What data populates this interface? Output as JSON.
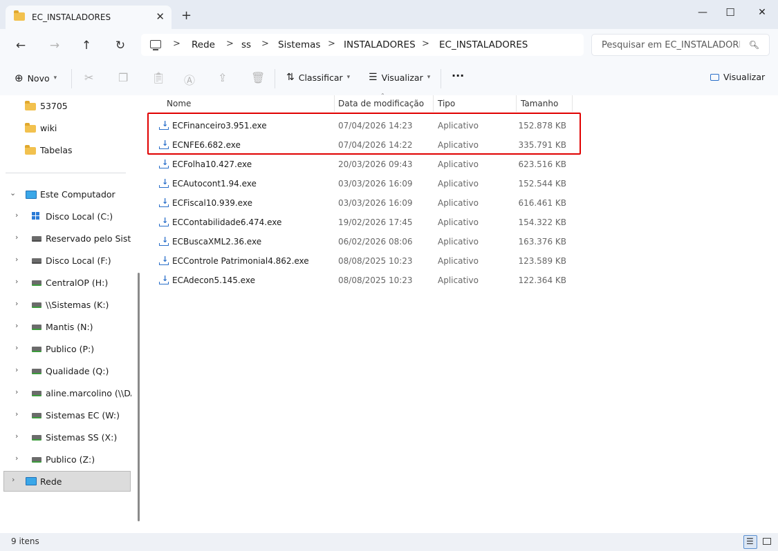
{
  "tab": {
    "title": "EC_INSTALADORES",
    "close": "✕",
    "new_tab": "+"
  },
  "window": {
    "minimize": "—",
    "maximize": "☐",
    "close": "✕"
  },
  "nav": {
    "back": "←",
    "forward": "→",
    "up": "↑",
    "refresh": "↻"
  },
  "breadcrumb": [
    "Rede",
    "ss",
    "Sistemas",
    "INSTALADORES",
    "EC_INSTALADORES"
  ],
  "search": {
    "placeholder": "Pesquisar em EC_INSTALADORES"
  },
  "toolbar": {
    "new_label": "Novo",
    "sort_label": "Classificar",
    "view_label": "Visualizar",
    "more": "···",
    "details_label": "Visualizar"
  },
  "sidebar": {
    "folders": [
      "53705",
      "wiki",
      "Tabelas"
    ],
    "computer_label": "Este Computador",
    "drives": [
      "Disco Local (C:)",
      "Reservado pelo Sistema",
      "Disco Local (F:)",
      "CentralOP (H:)",
      "\\\\Sistemas (K:)",
      "Mantis (N:)",
      "Publico (P:)",
      "Qualidade (Q:)",
      "aline.marcolino (\\\\DATA",
      "Sistemas EC (W:)",
      "Sistemas SS (X:)",
      "Publico (Z:)"
    ],
    "network_label": "Rede"
  },
  "columns": {
    "name": "Nome",
    "date": "Data de modificação",
    "type": "Tipo",
    "size": "Tamanho"
  },
  "files": [
    {
      "name": "ECFinanceiro3.951.exe",
      "date": "07/04/2026 14:23",
      "type": "Aplicativo",
      "size": "152.878 KB"
    },
    {
      "name": "ECNFE6.682.exe",
      "date": "07/04/2026 14:22",
      "type": "Aplicativo",
      "size": "335.791 KB"
    },
    {
      "name": "ECFolha10.427.exe",
      "date": "20/03/2026 09:43",
      "type": "Aplicativo",
      "size": "623.516 KB"
    },
    {
      "name": "ECAutocont1.94.exe",
      "date": "03/03/2026 16:09",
      "type": "Aplicativo",
      "size": "152.544 KB"
    },
    {
      "name": "ECFiscal10.939.exe",
      "date": "03/03/2026 16:09",
      "type": "Aplicativo",
      "size": "616.461 KB"
    },
    {
      "name": "ECContabilidade6.474.exe",
      "date": "19/02/2026 17:45",
      "type": "Aplicativo",
      "size": "154.322 KB"
    },
    {
      "name": "ECBuscaXML2.36.exe",
      "date": "06/02/2026 08:06",
      "type": "Aplicativo",
      "size": "163.376 KB"
    },
    {
      "name": "ECControle Patrimonial4.862.exe",
      "date": "08/08/2025 10:23",
      "type": "Aplicativo",
      "size": "123.589 KB"
    },
    {
      "name": "ECAdecon5.145.exe",
      "date": "08/08/2025 10:23",
      "type": "Aplicativo",
      "size": "122.364 KB"
    }
  ],
  "status": {
    "count": "9 itens"
  },
  "colors": {
    "highlight": "#e00000",
    "folder": "#f2c14e",
    "accent": "#2a6fc9"
  }
}
